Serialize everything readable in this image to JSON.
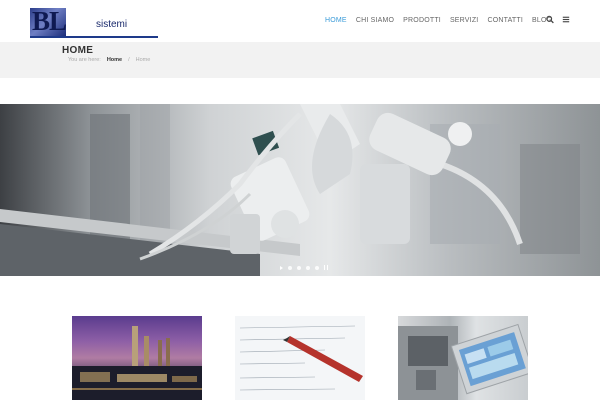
{
  "logo": {
    "letters": "BL",
    "sub": "sistemi"
  },
  "nav": {
    "items": [
      {
        "label": "HOME",
        "active": true
      },
      {
        "label": "CHI SIAMO",
        "active": false
      },
      {
        "label": "PRODOTTI",
        "active": false
      },
      {
        "label": "SERVIZI",
        "active": false
      },
      {
        "label": "CONTATTI",
        "active": false
      },
      {
        "label": "BLOG",
        "active": false
      }
    ],
    "icons": [
      "search-icon",
      "menu-icon"
    ]
  },
  "page": {
    "title": "HOME",
    "breadcrumb": {
      "prefix": "You are here:",
      "items": [
        "Home",
        "/",
        "Home"
      ]
    }
  },
  "hero": {
    "alt": "industrial robotic arm",
    "slides": 4,
    "active_slide": 1
  },
  "cards": [
    {
      "image": "industrial plant at dusk"
    },
    {
      "image": "technical calculations with pencil"
    },
    {
      "image": "industrial machine with touch panel"
    }
  ],
  "colors": {
    "accent": "#3a9bd8",
    "title_bar": "#f2f2f2",
    "logo_blue": "#1e3a8a"
  }
}
